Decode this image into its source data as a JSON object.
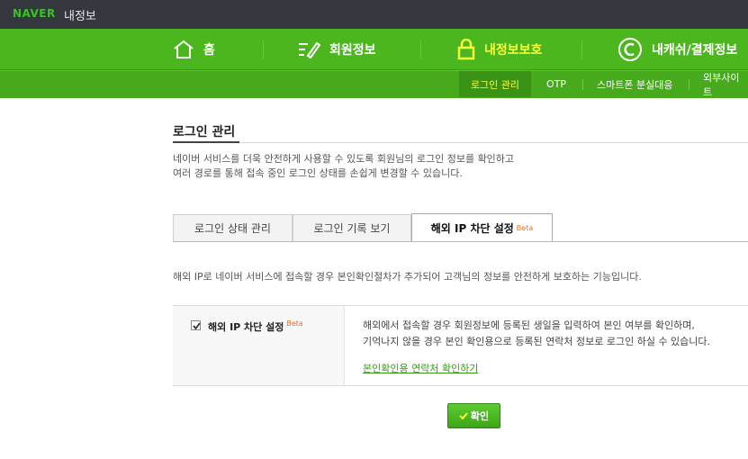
{
  "topbar": {
    "logo": "NAVER",
    "title": "내정보"
  },
  "main_nav": [
    {
      "label": "홈",
      "icon": "home-icon"
    },
    {
      "label": "회원정보",
      "icon": "edit-icon"
    },
    {
      "label": "내정보보호",
      "icon": "lock-icon",
      "active": true
    },
    {
      "label": "내캐쉬/결제정보",
      "icon": "cash-icon"
    }
  ],
  "sub_nav": [
    {
      "label": "로그인 관리",
      "active": true
    },
    {
      "label": "OTP"
    },
    {
      "label": "스마트폰 분실대응"
    },
    {
      "label": "외부사이트"
    }
  ],
  "page": {
    "title": "로그인 관리",
    "description_1": "네이버 서비스를 더욱 안전하게 사용할 수 있도록 회원님의 로그인 정보를 확인하고",
    "description_2": "여러 경로를 통해 접속 중인 로그인 상태를 손쉽게 변경할 수 있습니다."
  },
  "tabs": [
    {
      "label": "로그인 상태 관리"
    },
    {
      "label": "로그인 기록 보기"
    },
    {
      "label": "해외 IP 차단 설정",
      "badge": "Beta",
      "active": true
    }
  ],
  "intro": "해외 IP로 네이버 서비스에 접속할 경우 본인확인절차가 추가되어 고객님의 정보를 안전하게 보호하는 기능입니다.",
  "setting": {
    "label": "해외 IP 차단 설정",
    "badge": "Beta",
    "checked": true,
    "text_1": "해외에서 접속할 경우 회원정보에 등록된 생일을 입력하여 본인 여부를 확인하며,",
    "text_2": "기억나지 않을 경우 본인 확인용으로 등록된 연락처 정보로 로그인 하실 수 있습니다.",
    "link": "본인확인용 연락처 확인하기"
  },
  "confirm_button": "확인",
  "colors": {
    "accent": "#4cb61f",
    "active_text": "#f6ff3c",
    "beta": "#ff6a00",
    "link": "#3a9b1a"
  }
}
